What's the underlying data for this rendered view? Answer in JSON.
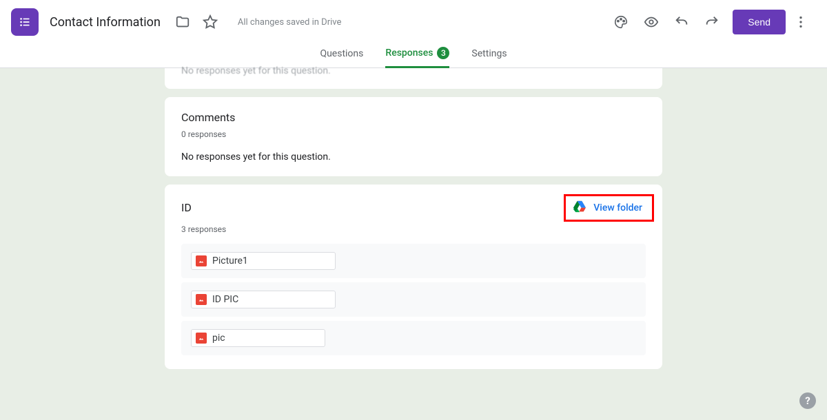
{
  "header": {
    "title": "Contact Information",
    "save_status": "All changes saved in Drive",
    "send_label": "Send"
  },
  "tabs": {
    "questions": "Questions",
    "responses": "Responses",
    "responses_count": "3",
    "settings": "Settings"
  },
  "partial_card": {
    "text": "No responses yet for this question."
  },
  "comments_card": {
    "title": "Comments",
    "sub": "0 responses",
    "empty": "No responses yet for this question."
  },
  "id_card": {
    "title": "ID",
    "sub": "3 responses",
    "view_folder_label": "View folder",
    "files": [
      {
        "name": "Picture1"
      },
      {
        "name": "ID PIC"
      },
      {
        "name": "pic"
      }
    ]
  },
  "help_label": "?"
}
